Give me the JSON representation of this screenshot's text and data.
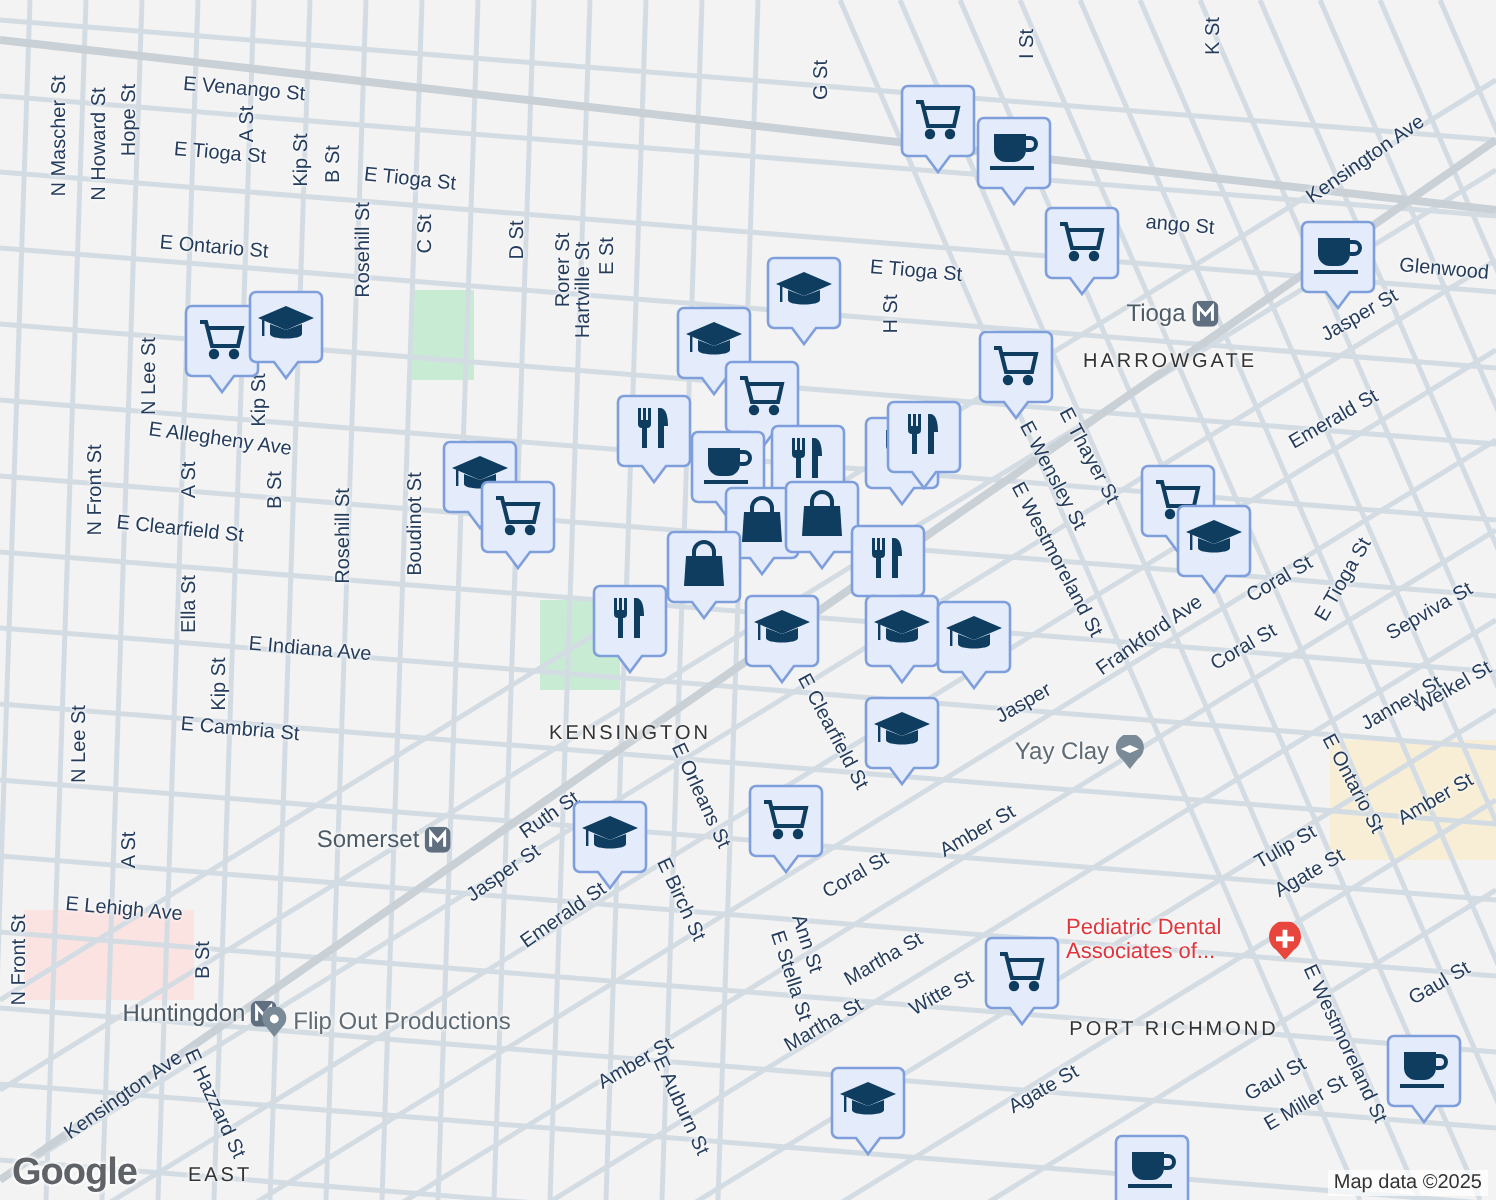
{
  "map": {
    "labels": [
      {
        "text": "E Venango St",
        "kind": "street"
      },
      {
        "text": "E Tioga St",
        "kind": "street"
      },
      {
        "text": "E Tioga St",
        "kind": "street"
      },
      {
        "text": "E Ontario St",
        "kind": "street"
      },
      {
        "text": "E Allegheny Ave",
        "kind": "street"
      },
      {
        "text": "E Clearfield St",
        "kind": "street"
      },
      {
        "text": "N Mascher St",
        "kind": "street"
      },
      {
        "text": "N Howard St",
        "kind": "street"
      },
      {
        "text": "Hope St",
        "kind": "street"
      },
      {
        "text": "A St",
        "kind": "street"
      },
      {
        "text": "Kip St",
        "kind": "street"
      },
      {
        "text": "B St",
        "kind": "street"
      },
      {
        "text": "Rosehill St",
        "kind": "street"
      },
      {
        "text": "C St",
        "kind": "street"
      },
      {
        "text": "N Lee St",
        "kind": "street"
      },
      {
        "text": "Kip St",
        "kind": "street"
      },
      {
        "text": "N Front St",
        "kind": "street"
      },
      {
        "text": "A St",
        "kind": "street"
      },
      {
        "text": "B St",
        "kind": "street"
      },
      {
        "text": "Rosehill St",
        "kind": "street"
      },
      {
        "text": "Boudinot St",
        "kind": "street"
      },
      {
        "text": "D St",
        "kind": "street"
      },
      {
        "text": "Rorer St",
        "kind": "street"
      },
      {
        "text": "Hartville St",
        "kind": "street"
      },
      {
        "text": "E St",
        "kind": "street"
      },
      {
        "text": "G St",
        "kind": "street"
      },
      {
        "text": "E Tioga St",
        "kind": "street"
      },
      {
        "text": "H St",
        "kind": "street"
      },
      {
        "text": "I St",
        "kind": "street"
      },
      {
        "text": "K St",
        "kind": "street"
      },
      {
        "text": "ango St",
        "kind": "street"
      },
      {
        "text": "Kensington Ave",
        "kind": "street"
      },
      {
        "text": "Glenwood",
        "kind": "street"
      },
      {
        "text": "Jasper St",
        "kind": "street"
      },
      {
        "text": "Tioga",
        "kind": "station"
      },
      {
        "text": "HARROWGATE",
        "kind": "district"
      },
      {
        "text": "Emerald St",
        "kind": "street"
      },
      {
        "text": "E Thayer St",
        "kind": "street"
      },
      {
        "text": "E Wensley St",
        "kind": "street"
      },
      {
        "text": "E Westmoreland St",
        "kind": "street"
      },
      {
        "text": "Frankford Ave",
        "kind": "street"
      },
      {
        "text": "Coral St",
        "kind": "street"
      },
      {
        "text": "E Tioga St",
        "kind": "street"
      },
      {
        "text": "Coral St",
        "kind": "street"
      },
      {
        "text": "Sepviva St",
        "kind": "street"
      },
      {
        "text": "Janney St",
        "kind": "street"
      },
      {
        "text": "Weikel St",
        "kind": "street"
      },
      {
        "text": "E Ontario St",
        "kind": "street"
      },
      {
        "text": "Tulip St",
        "kind": "street"
      },
      {
        "text": "Agate St",
        "kind": "street"
      },
      {
        "text": "Gaul St",
        "kind": "street"
      },
      {
        "text": "Gaul St",
        "kind": "street"
      },
      {
        "text": "E Miller St",
        "kind": "street"
      },
      {
        "text": "E Westmoreland St",
        "kind": "street"
      },
      {
        "text": "E Indiana Ave",
        "kind": "street"
      },
      {
        "text": "E Cambria St",
        "kind": "street"
      },
      {
        "text": "Ella St",
        "kind": "street"
      },
      {
        "text": "Kip St",
        "kind": "street"
      },
      {
        "text": "N Lee St",
        "kind": "street"
      },
      {
        "text": "A St",
        "kind": "street"
      },
      {
        "text": "E Lehigh Ave",
        "kind": "street"
      },
      {
        "text": "B St",
        "kind": "street"
      },
      {
        "text": "N Front St",
        "kind": "street"
      },
      {
        "text": "Kensington Ave",
        "kind": "street"
      },
      {
        "text": "E Hazzard St",
        "kind": "street"
      },
      {
        "text": "KENSINGTON",
        "kind": "district"
      },
      {
        "text": "Ruth St",
        "kind": "street"
      },
      {
        "text": "Jasper St",
        "kind": "street"
      },
      {
        "text": "Emerald St",
        "kind": "street"
      },
      {
        "text": "E Orleans St",
        "kind": "street"
      },
      {
        "text": "E Birch St",
        "kind": "street"
      },
      {
        "text": "E Clearfield St",
        "kind": "street"
      },
      {
        "text": "Jasper",
        "kind": "street"
      },
      {
        "text": "Coral St",
        "kind": "street"
      },
      {
        "text": "Amber St",
        "kind": "street"
      },
      {
        "text": "Amber St",
        "kind": "street"
      },
      {
        "text": "Ann St",
        "kind": "street"
      },
      {
        "text": "E Stella St",
        "kind": "street"
      },
      {
        "text": "Martha St",
        "kind": "street"
      },
      {
        "text": "Martha St",
        "kind": "street"
      },
      {
        "text": "Amber St",
        "kind": "street"
      },
      {
        "text": "E Auburn St",
        "kind": "street"
      },
      {
        "text": "Witte St",
        "kind": "street"
      },
      {
        "text": "Agate St",
        "kind": "street"
      },
      {
        "text": "Somerset",
        "kind": "station"
      },
      {
        "text": "Huntingdon",
        "kind": "station"
      },
      {
        "text": "Flip Out Productions",
        "kind": "poi"
      },
      {
        "text": "Yay Clay",
        "kind": "school"
      },
      {
        "text": "Pediatric Dental Associates of...",
        "kind": "hospital"
      },
      {
        "text": "PORT RICHMOND",
        "kind": "district"
      },
      {
        "text": "EAST",
        "kind": "district"
      }
    ],
    "pins": [
      {
        "kind": "cart"
      },
      {
        "kind": "coffee"
      },
      {
        "kind": "cart"
      },
      {
        "kind": "coffee"
      },
      {
        "kind": "school"
      },
      {
        "kind": "school"
      },
      {
        "kind": "cart"
      },
      {
        "kind": "school"
      },
      {
        "kind": "cart"
      },
      {
        "kind": "food"
      },
      {
        "kind": "cart"
      },
      {
        "kind": "school"
      },
      {
        "kind": "cart"
      },
      {
        "kind": "coffee"
      },
      {
        "kind": "food"
      },
      {
        "kind": "food"
      },
      {
        "kind": "food"
      },
      {
        "kind": "bag"
      },
      {
        "kind": "bag"
      },
      {
        "kind": "bag"
      },
      {
        "kind": "food"
      },
      {
        "kind": "food"
      },
      {
        "kind": "school"
      },
      {
        "kind": "school"
      },
      {
        "kind": "school"
      },
      {
        "kind": "school"
      },
      {
        "kind": "cart"
      },
      {
        "kind": "school"
      },
      {
        "kind": "cart"
      },
      {
        "kind": "school"
      },
      {
        "kind": "cart"
      },
      {
        "kind": "school"
      },
      {
        "kind": "coffee"
      },
      {
        "kind": "coffee"
      }
    ],
    "logo": "Google",
    "attribution": "Map data ©2025"
  }
}
